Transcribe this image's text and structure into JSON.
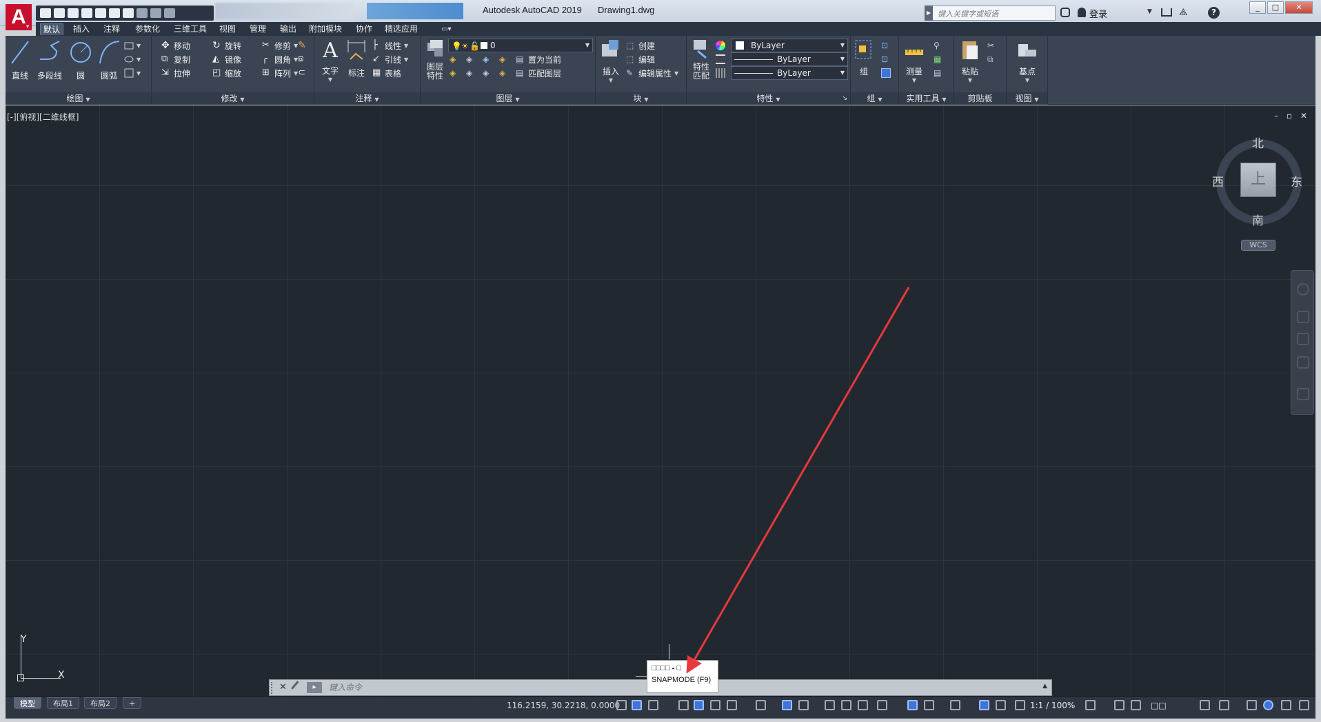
{
  "app": {
    "title": "Autodesk AutoCAD 2019",
    "document": "Drawing1.dwg",
    "logo_letter": "A"
  },
  "search": {
    "placeholder": "键入关键字或短语"
  },
  "header": {
    "login_label": "登录"
  },
  "window_buttons": {
    "minimize": "_",
    "restore": "□",
    "close": "✕"
  },
  "ribbon_tabs": [
    "默认",
    "插入",
    "注释",
    "参数化",
    "三维工具",
    "视图",
    "管理",
    "输出",
    "附加模块",
    "协作",
    "精选应用"
  ],
  "panels": {
    "draw": {
      "title": "绘图",
      "line": "直线",
      "polyline": "多段线",
      "circle": "圆",
      "arc": "圆弧"
    },
    "modify": {
      "title": "修改",
      "move": "移动",
      "rotate": "旋转",
      "trim": "修剪",
      "copy": "复制",
      "mirror": "镜像",
      "fillet": "圆角",
      "stretch": "拉伸",
      "scale": "缩放",
      "array": "阵列"
    },
    "annotation": {
      "title": "注释",
      "text": "文字",
      "dimension": "标注",
      "linear": "线性",
      "leader": "引线",
      "table": "表格"
    },
    "layers": {
      "title": "图层",
      "layer_properties": "图层\n特性",
      "current_layer": "0",
      "set_current": "置为当前",
      "match_layer": "匹配图层"
    },
    "block": {
      "title": "块",
      "insert": "插入",
      "create": "创建",
      "edit": "编辑",
      "edit_attributes": "编辑属性"
    },
    "properties": {
      "title": "特性",
      "match_properties": "特性\n匹配",
      "color": "ByLayer",
      "linetype": "ByLayer",
      "lineweight": "ByLayer"
    },
    "groups": {
      "title": "组",
      "group": "组"
    },
    "utilities": {
      "title": "实用工具",
      "measure": "测量"
    },
    "clipboard": {
      "title": "剪贴板",
      "paste": "粘贴"
    },
    "view": {
      "title": "视图",
      "base_point": "基点"
    }
  },
  "viewport": {
    "label": "[-][俯视][二维线框]",
    "controls": {
      "minimize": "–",
      "restore": "▫",
      "close": "✕"
    }
  },
  "viewcube": {
    "north": "北",
    "south": "南",
    "east": "东",
    "west": "西",
    "top": "上",
    "wcs": "WCS"
  },
  "ucs": {
    "x": "X",
    "y": "Y"
  },
  "tooltip": {
    "title": "□□□□ - □",
    "subtitle": "SNAPMODE (F9)"
  },
  "command_line": {
    "placeholder": "键入命令",
    "prompt_icon": "▸"
  },
  "layout_tabs": [
    "模型",
    "布局1",
    "布局2",
    "+"
  ],
  "status": {
    "coordinates": "116.2159, 30.2218, 0.0000",
    "scale": "1:1 / 100%",
    "frame_label": "□□"
  },
  "colors": {
    "viewport_bg": "#212830",
    "ribbon_bg": "#3b4453",
    "annotation_arrow": "#e8383d",
    "accent_blue": "#3f74d9"
  }
}
